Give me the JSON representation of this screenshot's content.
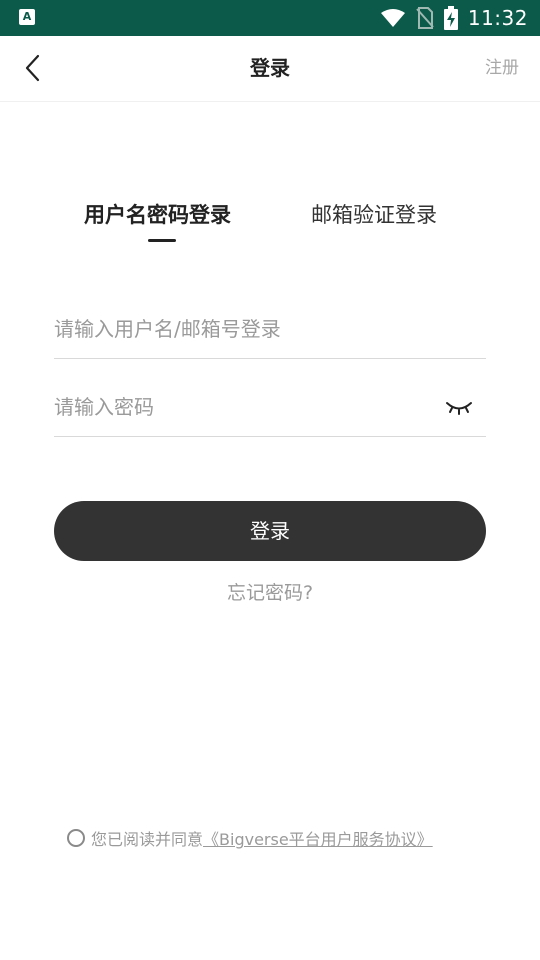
{
  "status_bar": {
    "app_icon_letter": "A",
    "time": "11:32",
    "icons": [
      "wifi-icon",
      "no-sim-icon",
      "battery-charging-icon"
    ]
  },
  "nav": {
    "back_icon": "chevron-left-icon",
    "title": "登录",
    "register": "注册"
  },
  "tabs": [
    {
      "label": "用户名密码登录",
      "active": true
    },
    {
      "label": "邮箱验证登录",
      "active": false
    }
  ],
  "form": {
    "username_placeholder": "请输入用户名/邮箱号登录",
    "username_value": "",
    "password_placeholder": "请输入密码",
    "password_value": "",
    "password_toggle_icon": "eye-closed-icon",
    "submit_label": "登录",
    "forgot_label": "忘记密码?"
  },
  "agreement": {
    "prefix": "您已阅读并同意",
    "link_text": "《Bigverse平台用户服务协议》",
    "checked": false
  }
}
